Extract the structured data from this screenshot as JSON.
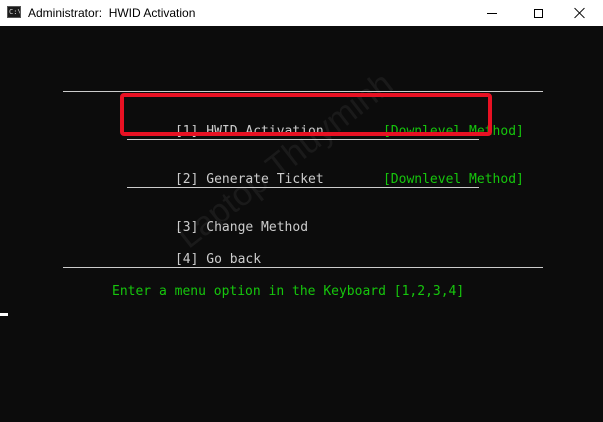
{
  "window": {
    "title": "Administrator:  HWID Activation",
    "icon": "console-icon",
    "controls": {
      "minimize": "minimize-icon",
      "maximize": "maximize-icon",
      "close": "close-icon"
    }
  },
  "menu": {
    "items": [
      {
        "label": "[1] HWID Activation",
        "tag": "[Downlevel Method]",
        "highlighted": true
      },
      {
        "label": "[2] Generate Ticket",
        "tag": "[Downlevel Method]"
      },
      {
        "label": "[3] Change Method",
        "tag": ""
      },
      {
        "label": "[4] Go back",
        "tag": ""
      }
    ],
    "prompt": "Enter a menu option in the Keyboard [1,2,3,4]"
  },
  "watermark": "Laptop Thuyminh",
  "colors": {
    "background": "#0c0c0c",
    "text": "#cccccc",
    "green": "#16c60c",
    "highlight": "#e81123"
  }
}
